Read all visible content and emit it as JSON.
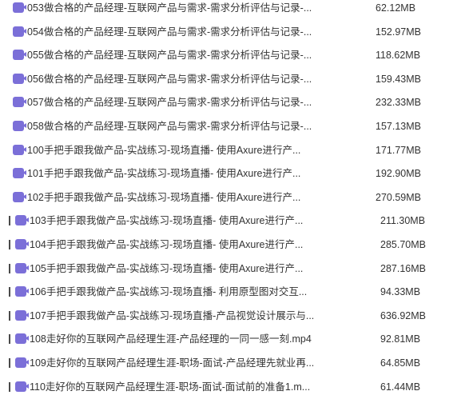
{
  "files": [
    {
      "name": "053做合格的产品经理-互联网产品与需求-需求分析评估与记录-...",
      "size": "62.12MB"
    },
    {
      "name": "054做合格的产品经理-互联网产品与需求-需求分析评估与记录-...",
      "size": "152.97MB"
    },
    {
      "name": "055做合格的产品经理-互联网产品与需求-需求分析评估与记录-...",
      "size": "118.62MB"
    },
    {
      "name": "056做合格的产品经理-互联网产品与需求-需求分析评估与记录-...",
      "size": "159.43MB"
    },
    {
      "name": "057做合格的产品经理-互联网产品与需求-需求分析评估与记录-...",
      "size": "232.33MB"
    },
    {
      "name": "058做合格的产品经理-互联网产品与需求-需求分析评估与记录-...",
      "size": "157.13MB"
    },
    {
      "name": "100手把手跟我做产品-实战练习-现场直播- 使用Axure进行产...",
      "size": "171.77MB"
    },
    {
      "name": "101手把手跟我做产品-实战练习-现场直播- 使用Axure进行产...",
      "size": "192.90MB"
    },
    {
      "name": "102手把手跟我做产品-实战练习-现场直播- 使用Axure进行产...",
      "size": "270.59MB"
    },
    {
      "name": "103手把手跟我做产品-实战练习-现场直播- 使用Axure进行产...",
      "size": "211.30MB"
    },
    {
      "name": "104手把手跟我做产品-实战练习-现场直播- 使用Axure进行产...",
      "size": "285.70MB"
    },
    {
      "name": "105手把手跟我做产品-实战练习-现场直播- 使用Axure进行产...",
      "size": "287.16MB"
    },
    {
      "name": "106手把手跟我做产品-实战练习-现场直播- 利用原型图对交互...",
      "size": "94.33MB"
    },
    {
      "name": "107手把手跟我做产品-实战练习-现场直播-产品视觉设计展示与...",
      "size": "636.92MB"
    },
    {
      "name": "108走好你的互联网产品经理生涯-产品经理的一同一感一刻.mp4",
      "size": "92.81MB"
    },
    {
      "name": "109走好你的互联网产品经理生涯-职场-面试-产品经理先就业再...",
      "size": "64.85MB"
    },
    {
      "name": "110走好你的互联网产品经理生涯-职场-面试-面试前的准备1.m...",
      "size": "61.44MB"
    }
  ],
  "icon": {
    "name": "video-file-icon",
    "color": "#7b6fd8"
  }
}
